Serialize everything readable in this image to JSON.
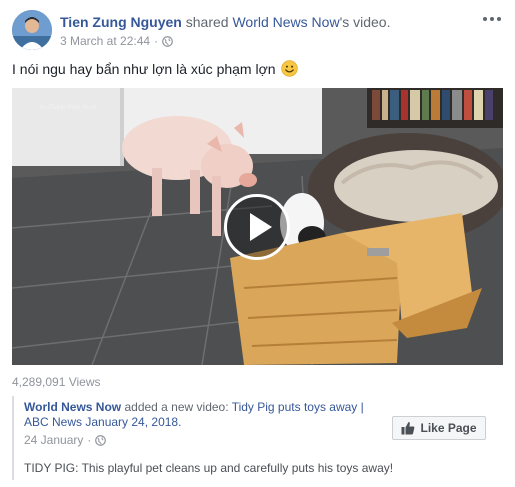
{
  "post": {
    "author": "Tien Zung Nguyen",
    "action": "shared",
    "shared_from": "World News Now",
    "shared_suffix": "'s video.",
    "timestamp": "3 March at 22:44",
    "audience_icon": "globe-icon",
    "more_icon": "more-options-icon",
    "text": "I nói ngu hay bẩn như lợn là xúc phạm lợn",
    "emoji": "smiley-emoji"
  },
  "video": {
    "watermark": "YouTube/ Pavi Hunt",
    "play_icon": "play-icon",
    "views": "4,289,091 Views"
  },
  "shared_card": {
    "page_name": "World News Now",
    "action_text": "added a new video:",
    "video_title": "Tidy Pig puts toys away | ABC News January 24, 2018.",
    "date": "24 January",
    "audience_icon": "globe-icon",
    "like_button_label": "Like Page",
    "like_icon": "thumbs-up-icon",
    "description": "TIDY PIG: This playful pet cleans up and carefully puts his toys away!"
  },
  "colors": {
    "link": "#365899",
    "meta": "#90949c",
    "text": "#1d2129"
  }
}
